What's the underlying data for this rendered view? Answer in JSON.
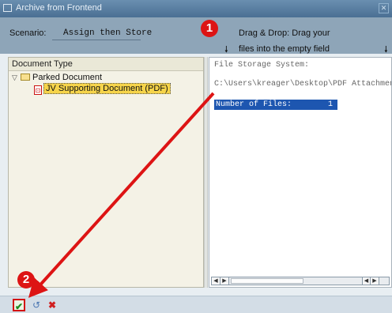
{
  "window": {
    "title": "Archive from Frontend"
  },
  "header": {
    "scenario_label": "Scenario:",
    "scenario_value": "Assign then Store",
    "drag_line1": "Drag & Drop: Drag your",
    "drag_line2": "files into the empty field"
  },
  "tree": {
    "header": "Document Type",
    "parent": "Parked Document",
    "child": "JV Supporting Document (PDF)"
  },
  "storage": {
    "fs_label": "File Storage System:",
    "path": "C:\\Users\\kreager\\Desktop\\PDF Attachments",
    "files_label": "Number of Files:",
    "files_count": "1"
  },
  "annotations": {
    "step1": "1",
    "step2": "2"
  },
  "icons": {
    "ok": "check-icon",
    "reset": "reset-icon",
    "cancel": "cancel-icon",
    "folder": "folder-icon",
    "pdf": "pdf-icon"
  },
  "colors": {
    "annotation_red": "#dd1414",
    "selection_blue": "#1d56b0",
    "tree_highlight": "#f6d44a"
  }
}
